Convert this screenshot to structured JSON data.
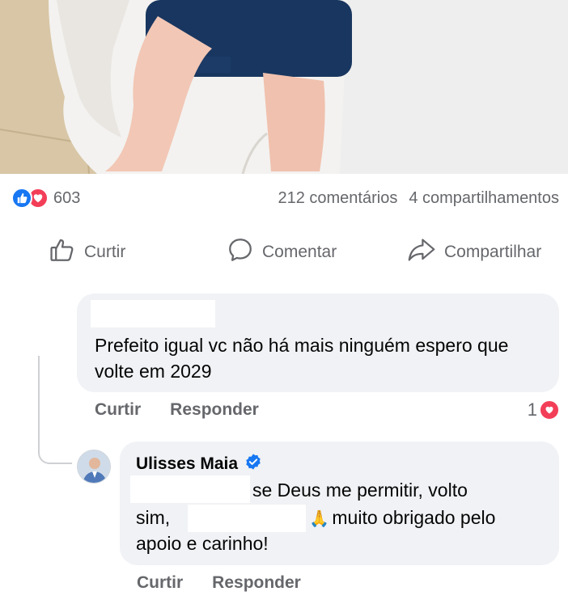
{
  "post": {
    "reaction_count": "603",
    "comments_count": "212 comentários",
    "shares_count": "4 compartilhamentos"
  },
  "actions": {
    "like": "Curtir",
    "comment": "Comentar",
    "share": "Compartilhar"
  },
  "comment": {
    "text": "Prefeito igual vc não há mais ninguém espero que volte em 2029",
    "like_label": "Curtir",
    "reply_label": "Responder",
    "reaction_count": "1"
  },
  "reply": {
    "author": "Ulisses Maia",
    "line1": "se Deus me permitir, volto",
    "line2a": "sim,",
    "line2b": "muito obrigado pelo",
    "line3": "apoio e carinho!",
    "like_label": "Curtir",
    "reply_label": "Responder"
  },
  "icons": [
    "like-icon",
    "love-icon",
    "thumbs-up-icon",
    "comment-icon",
    "share-icon",
    "verified-icon",
    "praying-hands-icon",
    "heart-icon"
  ],
  "colors": {
    "facebook_blue": "#1877f2",
    "love_red": "#f33e58",
    "secondary_text": "#65676b",
    "bubble_bg": "#f0f2f5"
  }
}
